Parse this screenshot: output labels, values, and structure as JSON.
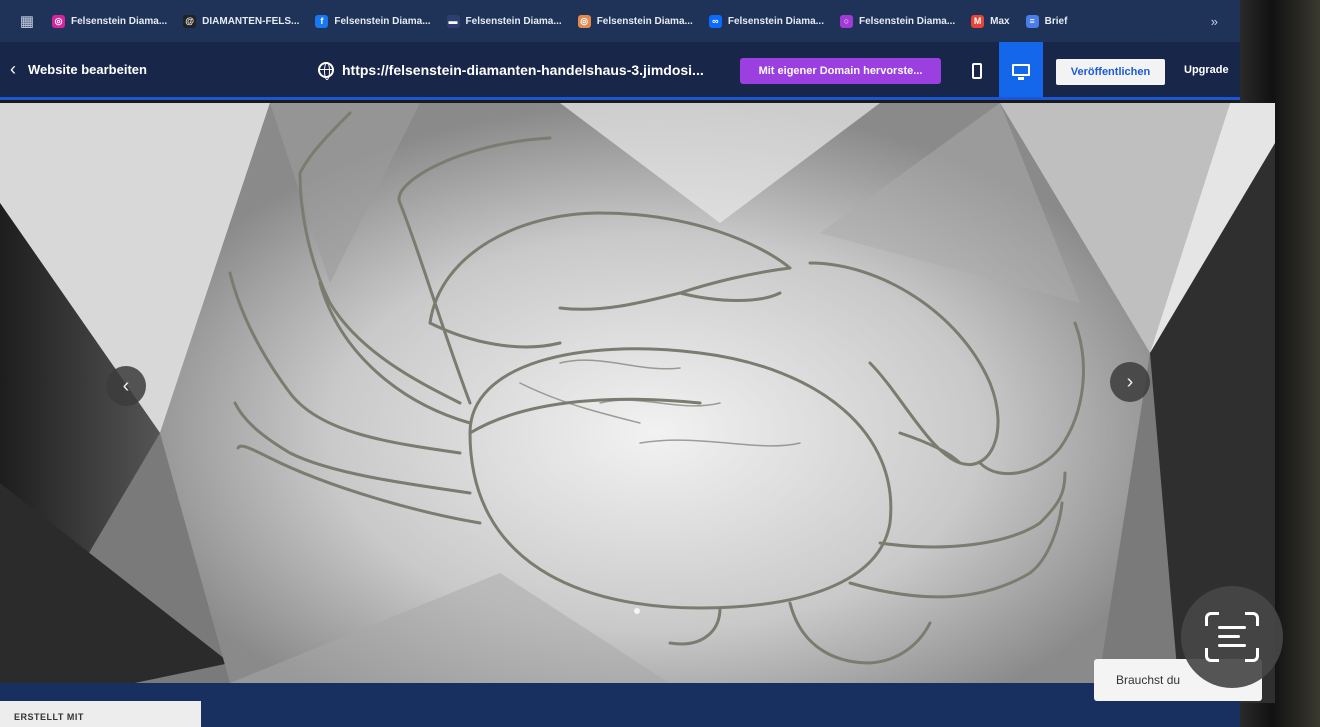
{
  "bookmarks": [
    {
      "label": "Felsenstein Diama...",
      "icon": "instagram-icon",
      "color": "#d6249f"
    },
    {
      "label": "DIAMANTEN-FELS...",
      "icon": "threads-icon",
      "color": "#222222"
    },
    {
      "label": "Felsenstein Diama...",
      "icon": "facebook-icon",
      "color": "#1877f2"
    },
    {
      "label": "Felsenstein Diama...",
      "icon": "page-icon",
      "color": "#2d3f70"
    },
    {
      "label": "Felsenstein Diama...",
      "icon": "instagram-icon",
      "color": "#e08a50"
    },
    {
      "label": "Felsenstein Diama...",
      "icon": "meta-icon",
      "color": "#0a6cff"
    },
    {
      "label": "Felsenstein Diama...",
      "icon": "circle-icon",
      "color": "#a23ad6"
    },
    {
      "label": "Max",
      "icon": "gmail-icon",
      "color": "#ea4335"
    },
    {
      "label": "Brief",
      "icon": "docs-icon",
      "color": "#4a7de8"
    }
  ],
  "bookmarks_more": "»",
  "editor": {
    "back_label": "Website bearbeiten",
    "url": "https://felsenstein-diamanten-handelshaus-3.jimdosi...",
    "domain_button": "Mit eigener Domain hervorste...",
    "publish_button": "Veröffentlichen",
    "upgrade_button": "Upgrade",
    "active_view": "desktop",
    "accent_color": "#1467ea"
  },
  "slider": {
    "prev_symbol": "‹",
    "next_symbol": "›",
    "image_subject": "engraved crab on diamond facet background"
  },
  "footer": {
    "made_with": "ERSTELLT MIT",
    "chat_prompt": "Brauchst du"
  }
}
